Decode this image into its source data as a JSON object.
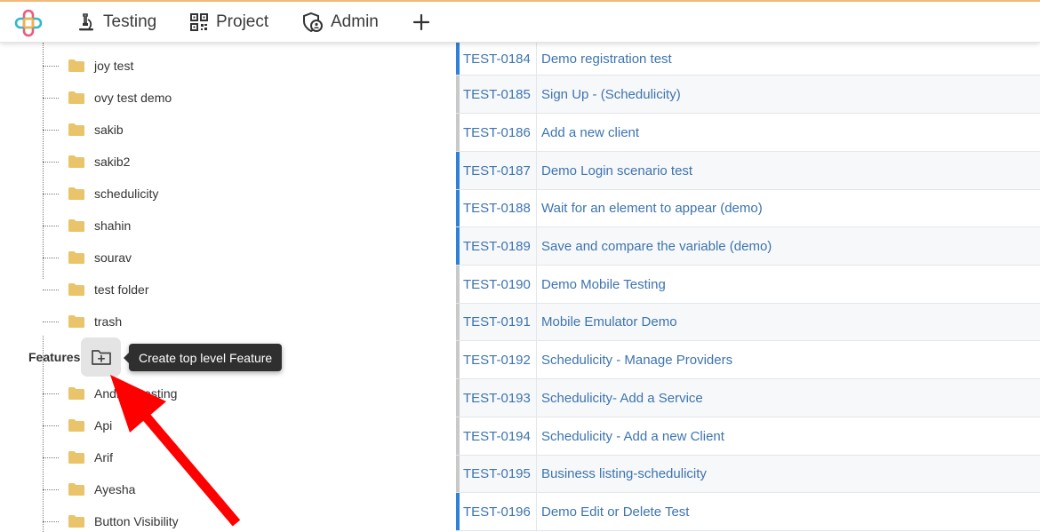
{
  "nav": {
    "items": [
      {
        "label": "Testing",
        "icon": "microscope-icon"
      },
      {
        "label": "Project",
        "icon": "qr-code-icon"
      },
      {
        "label": "Admin",
        "icon": "shield-user-icon"
      }
    ],
    "add_icon": "plus-icon"
  },
  "tree": {
    "folder_color": "#e9c46a",
    "folders_top": [
      "joy test",
      "ovy test demo",
      "sakib",
      "sakib2",
      "schedulicity",
      "shahin",
      "sourav",
      "test folder",
      "trash"
    ],
    "features_title": "Features",
    "add_feature_tooltip": "Create top level Feature",
    "features": [
      "Android testing",
      "Api",
      "Arif",
      "Ayesha",
      "Button Visibility"
    ]
  },
  "tests": {
    "rows": [
      {
        "id": "TEST-0184",
        "name": "Demo registration test",
        "marker": "blue"
      },
      {
        "id": "TEST-0185",
        "name": "Sign Up - (Schedulicity)",
        "marker": "gray"
      },
      {
        "id": "TEST-0186",
        "name": "Add a new client",
        "marker": "gray"
      },
      {
        "id": "TEST-0187",
        "name": "Demo Login scenario test",
        "marker": "blue"
      },
      {
        "id": "TEST-0188",
        "name": "Wait for an element to appear (demo)",
        "marker": "blue"
      },
      {
        "id": "TEST-0189",
        "name": "Save and compare the variable (demo)",
        "marker": "blue"
      },
      {
        "id": "TEST-0190",
        "name": "Demo Mobile Testing",
        "marker": "gray"
      },
      {
        "id": "TEST-0191",
        "name": "Mobile Emulator Demo",
        "marker": "gray"
      },
      {
        "id": "TEST-0192",
        "name": "Schedulicity - Manage Providers",
        "marker": "gray"
      },
      {
        "id": "TEST-0193",
        "name": "Schedulicity- Add a Service",
        "marker": "gray"
      },
      {
        "id": "TEST-0194",
        "name": "Schedulicity - Add a new Client",
        "marker": "gray"
      },
      {
        "id": "TEST-0195",
        "name": "Business listing-schedulicity",
        "marker": "gray"
      },
      {
        "id": "TEST-0196",
        "name": "Demo Edit or Delete Test",
        "marker": "blue"
      }
    ]
  }
}
